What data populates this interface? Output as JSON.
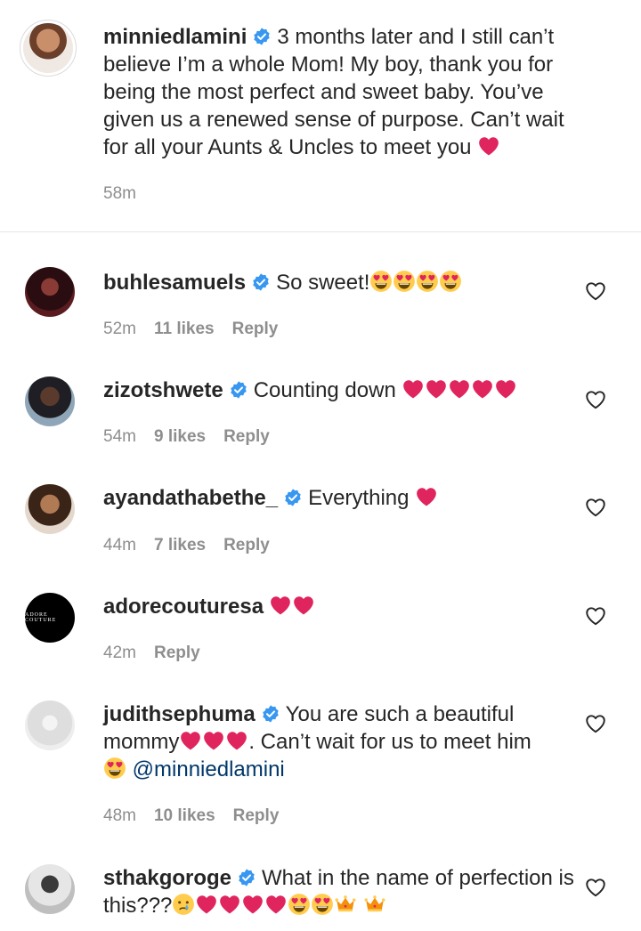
{
  "caption": {
    "username": "minniedlamini",
    "text": "3 months later and I still can’t believe I’m a whole Mom! My boy, thank you for being the most perfect and sweet baby. You’ve given us a renewed sense of purpose. Can’t wait for all your Aunts & Uncles to meet you",
    "time": "58m"
  },
  "comments": [
    {
      "username": "buhlesamuels",
      "verified": true,
      "text": "So sweet!",
      "time": "52m",
      "likes": "11 likes",
      "reply": "Reply"
    },
    {
      "username": "zizotshwete",
      "verified": true,
      "text": "Counting down",
      "time": "54m",
      "likes": "9 likes",
      "reply": "Reply"
    },
    {
      "username": "ayandathabethe_",
      "verified": true,
      "text": "Everything",
      "time": "44m",
      "likes": "7 likes",
      "reply": "Reply"
    },
    {
      "username": "adorecouturesa",
      "verified": false,
      "text": "",
      "time": "42m",
      "likes": "",
      "reply": "Reply",
      "avatar_text": "ADORE COUTURE"
    },
    {
      "username": "judithsephuma",
      "verified": true,
      "text_a": "You are such a beautiful mommy",
      "text_b": ". Can’t wait for us to meet him",
      "mention": "@minniedlamini",
      "time": "48m",
      "likes": "10 likes",
      "reply": "Reply"
    },
    {
      "username": "sthakgoroge",
      "verified": true,
      "text": "What in the name of perfection is this???",
      "time": "",
      "likes": "",
      "reply": ""
    }
  ],
  "colors": {
    "text": "#262626",
    "meta": "#8e8e8e",
    "verified": "#3897f0",
    "heart": "#e0245e",
    "mention": "#00376b"
  },
  "icons": [
    "verified-badge-icon",
    "heart-outline-icon",
    "red-heart-emoji",
    "heart-eyes-emoji",
    "crying-emoji",
    "crown-emoji"
  ]
}
